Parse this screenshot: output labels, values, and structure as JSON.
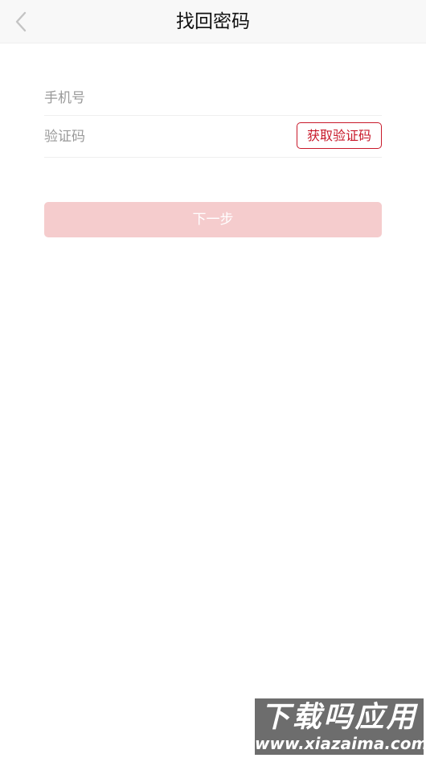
{
  "navbar": {
    "title": "找回密码",
    "back_icon": "chevron-left-icon"
  },
  "form": {
    "phone": {
      "placeholder": "手机号",
      "value": ""
    },
    "code": {
      "placeholder": "验证码",
      "value": ""
    },
    "get_code_label": "获取验证码"
  },
  "next_label": "下一步",
  "watermark": {
    "line1": "下载吗应用",
    "line2": "www.xiazaima.com"
  },
  "colors": {
    "accent": "#c8192a",
    "next_button_disabled": "#f5cccd",
    "navbar_bg": "#f8f8f8"
  }
}
